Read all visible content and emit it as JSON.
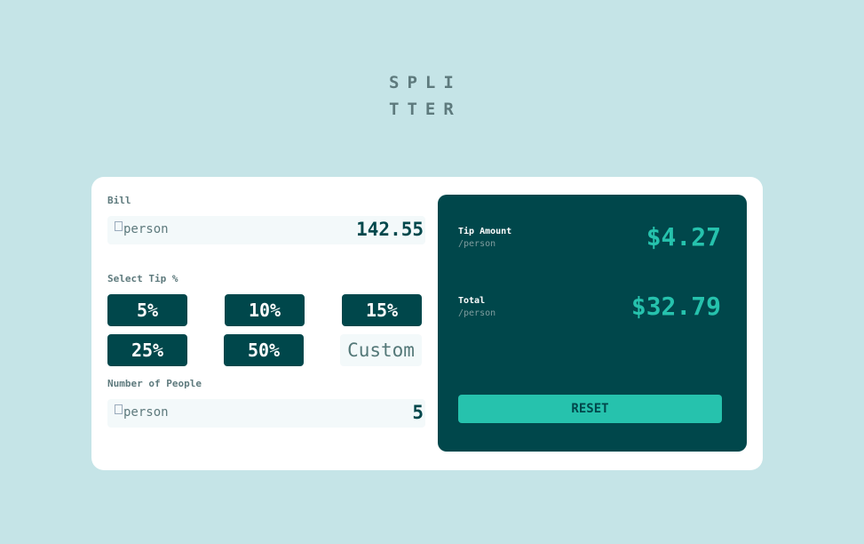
{
  "logo": {
    "line1": "SPLI",
    "line2": "TTER"
  },
  "bill": {
    "label": "Bill",
    "icon_alt": "person",
    "value": "142.55"
  },
  "tips": {
    "label": "Select Tip %",
    "options": [
      "5%",
      "10%",
      "15%",
      "25%",
      "50%"
    ],
    "custom": "Custom"
  },
  "people": {
    "label": "Number of People",
    "icon_alt": "person",
    "value": "5"
  },
  "results": {
    "tip_label": "Tip Amount",
    "tip_sub": "/person",
    "tip_value": "$4.27",
    "total_label": "Total",
    "total_sub": "/person",
    "total_value": "$32.79",
    "reset_label": "RESET"
  },
  "colors": {
    "background": "#c5e4e7",
    "dark_cyan": "#00474b",
    "accent": "#26c2ad"
  }
}
